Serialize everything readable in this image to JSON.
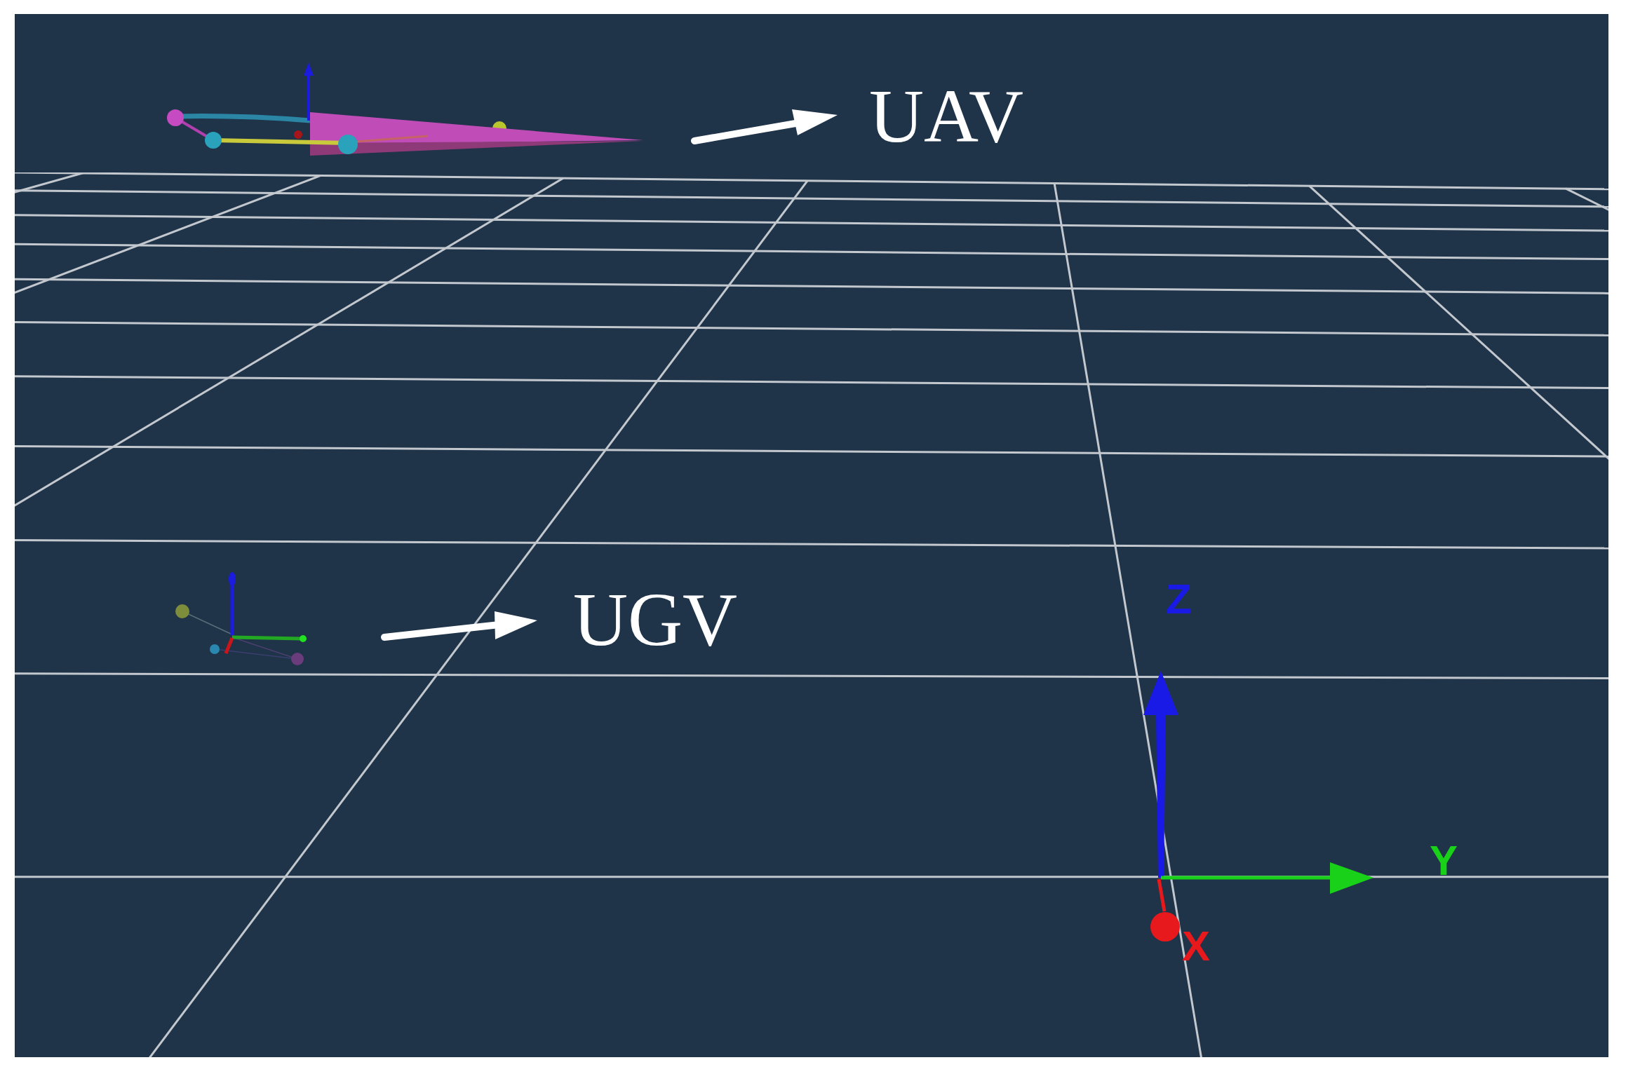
{
  "scene": {
    "vehicles": [
      {
        "kind": "aerial",
        "label": "UAV"
      },
      {
        "kind": "ground",
        "label": "UGV"
      }
    ],
    "axes": [
      {
        "kind": "vertical",
        "label": "Z",
        "color": "#1a1ae6"
      },
      {
        "kind": "horizontal",
        "label": "Y",
        "color": "#19d119"
      },
      {
        "kind": "depth",
        "label": "X",
        "color": "#e8191c"
      }
    ]
  }
}
